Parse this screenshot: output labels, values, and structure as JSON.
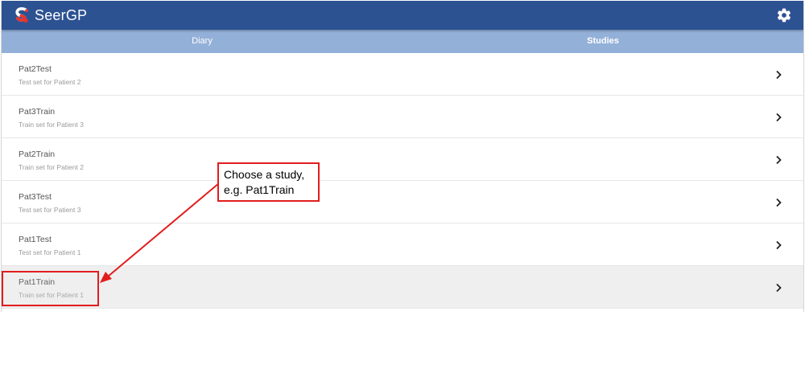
{
  "app": {
    "brand": "SeerGP"
  },
  "tabs": [
    {
      "label": "Diary"
    },
    {
      "label": "Studies"
    }
  ],
  "studies": [
    {
      "name": "Pat2Test",
      "description": "Test set for Patient 2"
    },
    {
      "name": "Pat3Train",
      "description": "Train set for Patient 3"
    },
    {
      "name": "Pat2Train",
      "description": "Train set for Patient 2"
    },
    {
      "name": "Pat3Test",
      "description": "Test set for Patient 3"
    },
    {
      "name": "Pat1Test",
      "description": "Test set for Patient 1"
    },
    {
      "name": "Pat1Train",
      "description": "Train set for Patient 1"
    }
  ],
  "annotation": {
    "line1": "Choose a study,",
    "line2": "e.g. Pat1Train"
  },
  "colors": {
    "header": "#2d5292",
    "tabbar": "#93b0d8",
    "logo": "#e8332a",
    "annotation": "#e11d1d",
    "selected_row": "#efefef"
  },
  "icons": {
    "logo": "seergp-logo",
    "settings": "gear-icon",
    "row_chevron": "chevron-right-icon"
  }
}
